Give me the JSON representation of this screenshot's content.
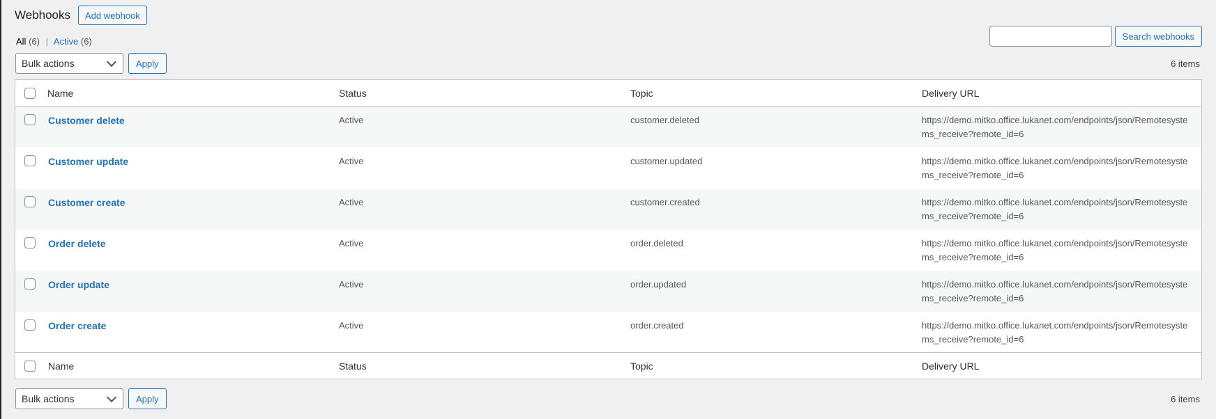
{
  "header": {
    "title": "Webhooks",
    "add_button": "Add webhook"
  },
  "filters": {
    "all_label": "All",
    "all_count": "(6)",
    "separator": "|",
    "active_label": "Active",
    "active_count": "(6)"
  },
  "search": {
    "button_label": "Search webhooks",
    "placeholder": ""
  },
  "tablenav": {
    "bulk_label": "Bulk actions",
    "apply_label": "Apply",
    "items_count": "6 items"
  },
  "columns": {
    "name": "Name",
    "status": "Status",
    "topic": "Topic",
    "delivery_url": "Delivery URL"
  },
  "rows": [
    {
      "name": "Customer delete",
      "status": "Active",
      "topic": "customer.deleted",
      "url": "https://demo.mitko.office.lukanet.com/endpoints/json/Remotesystems_receive?remote_id=6"
    },
    {
      "name": "Customer update",
      "status": "Active",
      "topic": "customer.updated",
      "url": "https://demo.mitko.office.lukanet.com/endpoints/json/Remotesystems_receive?remote_id=6"
    },
    {
      "name": "Customer create",
      "status": "Active",
      "topic": "customer.created",
      "url": "https://demo.mitko.office.lukanet.com/endpoints/json/Remotesystems_receive?remote_id=6"
    },
    {
      "name": "Order delete",
      "status": "Active",
      "topic": "order.deleted",
      "url": "https://demo.mitko.office.lukanet.com/endpoints/json/Remotesystems_receive?remote_id=6"
    },
    {
      "name": "Order update",
      "status": "Active",
      "topic": "order.updated",
      "url": "https://demo.mitko.office.lukanet.com/endpoints/json/Remotesystems_receive?remote_id=6"
    },
    {
      "name": "Order create",
      "status": "Active",
      "topic": "order.created",
      "url": "https://demo.mitko.office.lukanet.com/endpoints/json/Remotesystems_receive?remote_id=6"
    }
  ],
  "colors": {
    "link": "#2271b1",
    "background": "#f0f0f1",
    "border": "#c3c4c7"
  }
}
